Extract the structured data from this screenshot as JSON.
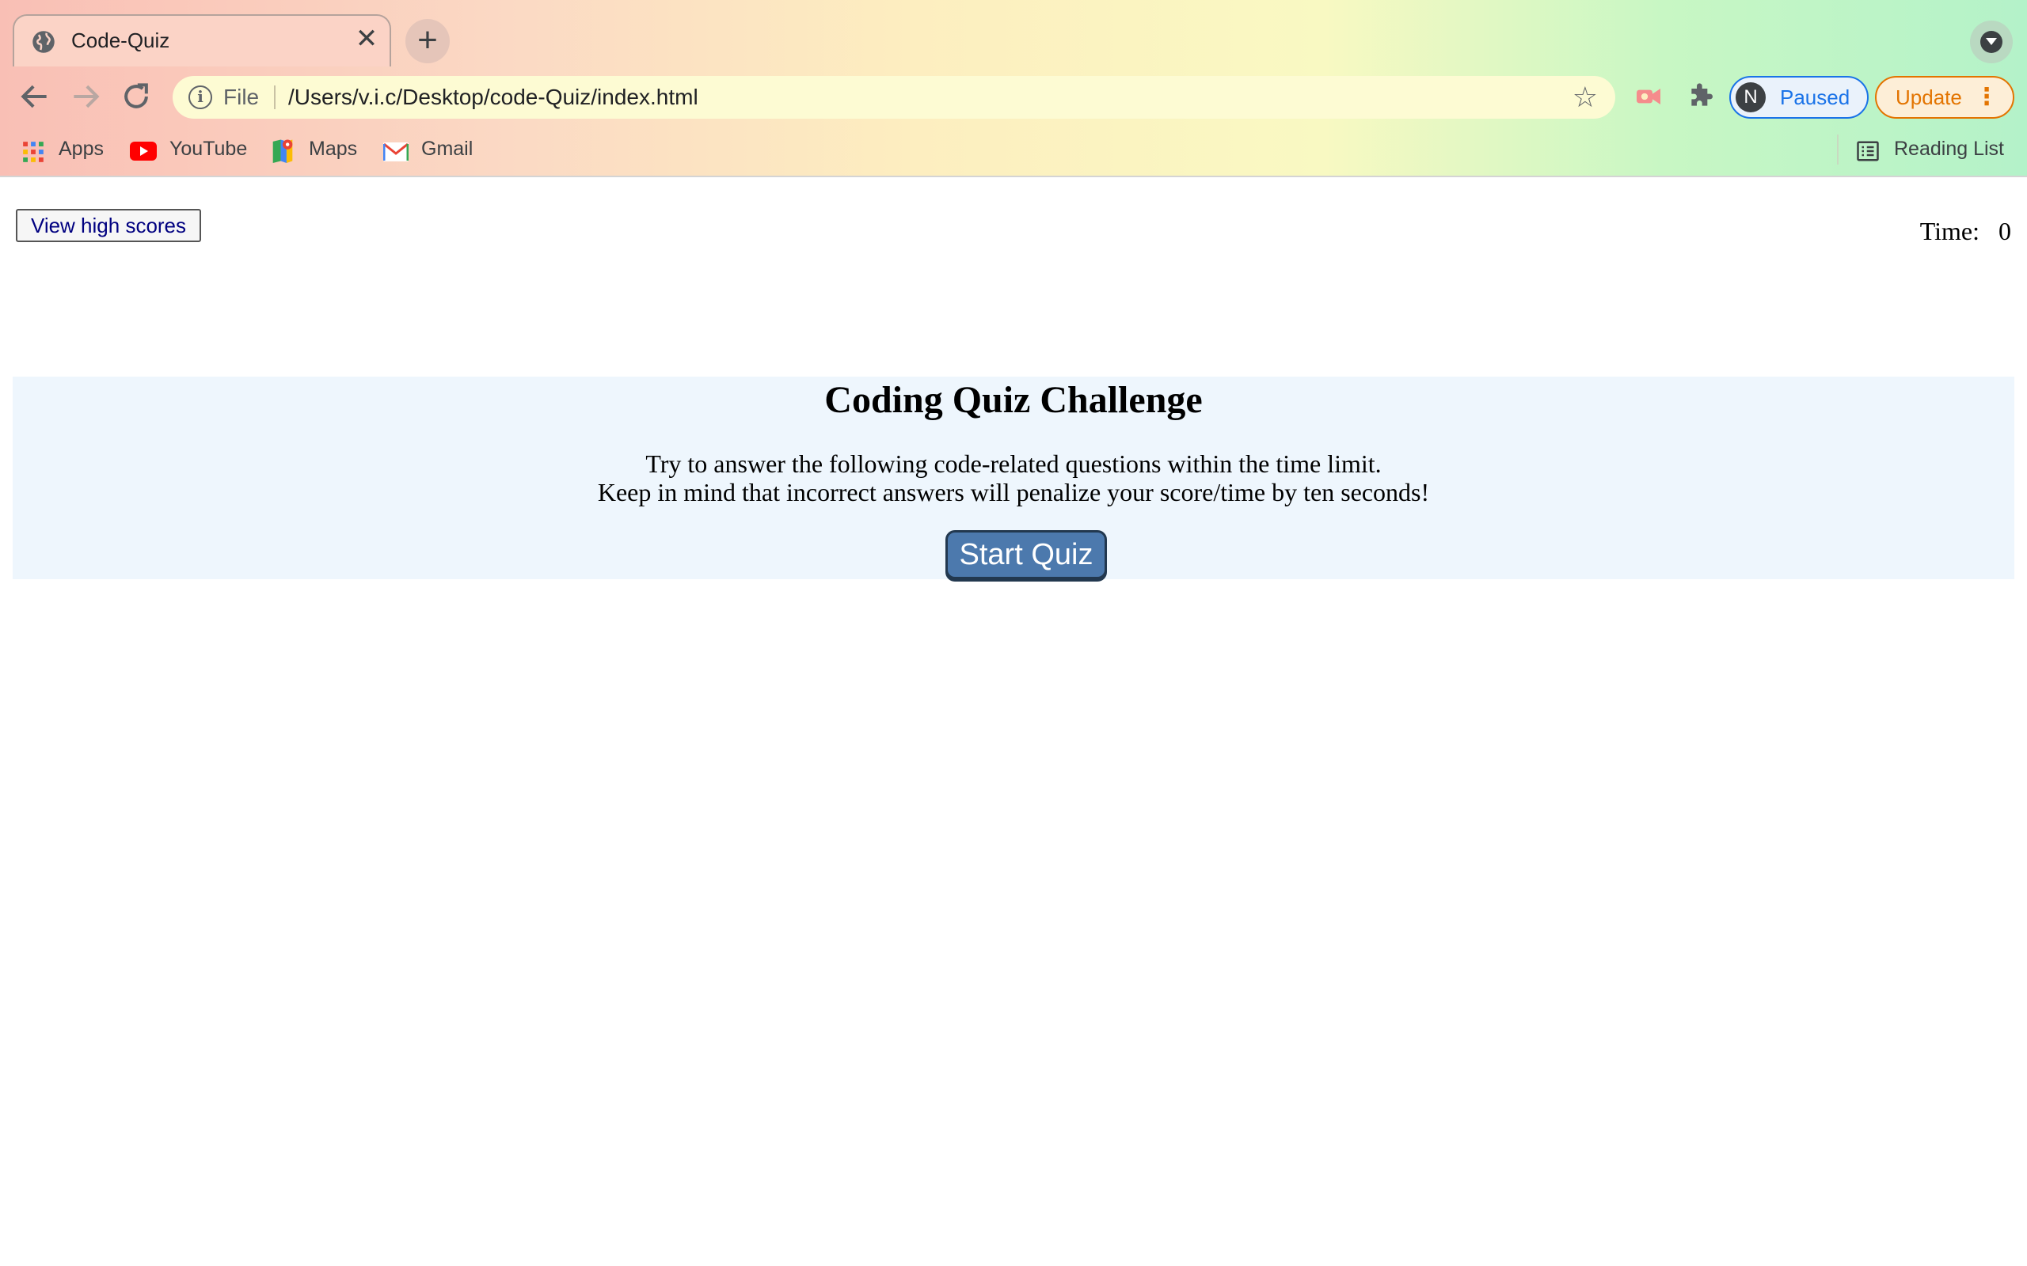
{
  "browser": {
    "tab": {
      "title": "Code-Quiz",
      "close_glyph": "✕"
    },
    "new_tab_glyph": "+",
    "address_bar": {
      "scheme_label": "File",
      "url": "/Users/v.i.c/Desktop/code-Quiz/index.html"
    },
    "profile": {
      "initial": "N",
      "label": "Paused"
    },
    "update": {
      "label": "Update",
      "menu_glyph": "⋮"
    },
    "bookmarks": [
      {
        "label": "Apps",
        "icon": "apps-grid-icon"
      },
      {
        "label": "YouTube",
        "icon": "youtube-icon"
      },
      {
        "label": "Maps",
        "icon": "maps-icon"
      },
      {
        "label": "Gmail",
        "icon": "gmail-icon"
      }
    ],
    "reading_list": "Reading List",
    "colors": {
      "profile_blue": "#1a73e8",
      "update_orange": "#e37400"
    }
  },
  "page": {
    "view_high_scores": "View high scores",
    "time_label": "Time:",
    "time_value": "0",
    "title": "Coding Quiz Challenge",
    "instructions": [
      "Try to answer the following code-related questions within the time limit.",
      "Keep in mind that incorrect answers will penalize your score/time by ten seconds!"
    ],
    "start_button": "Start Quiz",
    "colors": {
      "intro_bg": "#eef6fd",
      "start_button_bg": "#4c79ad"
    }
  }
}
